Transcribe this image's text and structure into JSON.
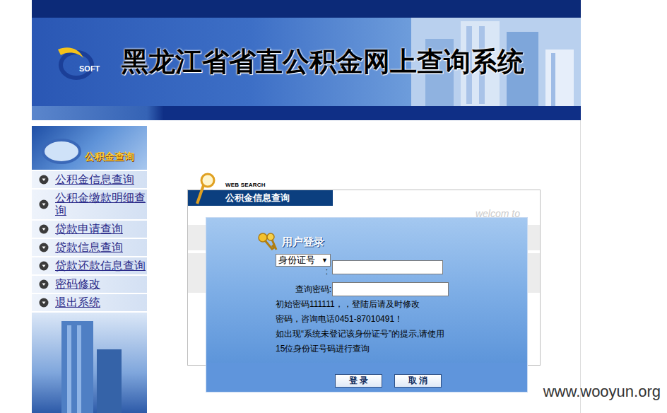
{
  "header": {
    "title": "黑龙江省省直公积金网上查询系统",
    "logo_text": "SOFT"
  },
  "sidebar": {
    "title": "公积金查询",
    "items": [
      "公积金信息查询",
      "公积金缴款明细查询",
      "贷款申请查询",
      "贷款信息查询",
      "贷款还款信息查询",
      "密码修改",
      "退出系统"
    ]
  },
  "panel": {
    "tag": "WEB SEARCH",
    "title": "公积金信息查询",
    "welcome": "welcom to"
  },
  "login": {
    "title": "用户登录",
    "id_type": "身份证号",
    "dropdown_arrow": "▼",
    "id_colon": ":",
    "password_label": "查询密码:",
    "notes": [
      "初始密码111111，，登陆后请及时修改",
      "密码，咨询电话0451-87010491！",
      "如出现“系统未登记该身份证号”的提示,请使用",
      "15位身份证号码进行查询"
    ],
    "buttons": [
      "登 录",
      "取 消"
    ]
  },
  "watermark": "www.wooyun.org"
}
